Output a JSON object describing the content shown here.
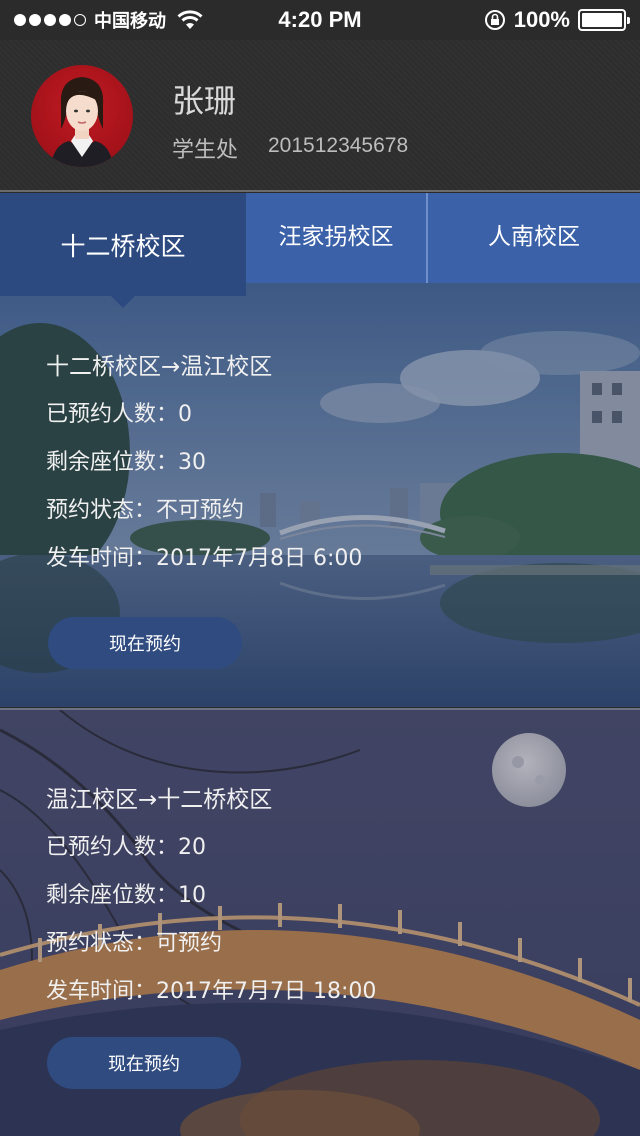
{
  "status_bar": {
    "carrier": "中国移动",
    "time": "4:20 PM",
    "battery": "100%",
    "signal_bars": 4,
    "signal_total": 5
  },
  "profile": {
    "name": "张珊",
    "department": "学生处",
    "student_id": "201512345678"
  },
  "tabs": [
    {
      "label": "十二桥校区",
      "selected": true
    },
    {
      "label": "汪家拐校区",
      "selected": false
    },
    {
      "label": "人南校区",
      "selected": false
    }
  ],
  "routes": [
    {
      "title": "十二桥校区→温江校区",
      "booked": "已预约人数：0",
      "seats": "剩余座位数：30",
      "status": "预约状态：不可预约",
      "departure": "发车时间：2017年7月8日 6:00",
      "button": "现在预约"
    },
    {
      "title": "温江校区→十二桥校区",
      "booked": "已预约人数：20",
      "seats": "剩余座位数：10",
      "status": "预约状态：可预约",
      "departure": "发车时间：2017年7月7日 18:00",
      "button": "现在预约"
    }
  ],
  "colors": {
    "tab_bar": "#3b62a8",
    "tab_selected": "#2c4a80",
    "button": "#2f4b80"
  }
}
